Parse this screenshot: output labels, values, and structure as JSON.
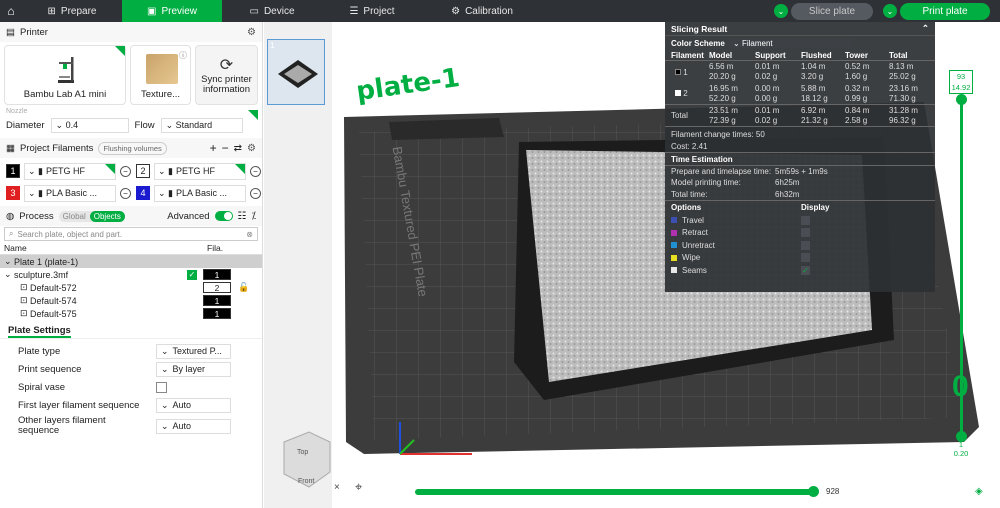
{
  "tabs": [
    {
      "label": "Prepare",
      "icon": "prepare-icon"
    },
    {
      "label": "Preview",
      "icon": "preview-icon"
    },
    {
      "label": "Device",
      "icon": "device-icon"
    },
    {
      "label": "Project",
      "icon": "project-icon"
    },
    {
      "label": "Calibration",
      "icon": "calibration-icon"
    }
  ],
  "actions": {
    "slice": "Slice plate",
    "print": "Print plate"
  },
  "printer": {
    "title": "Printer",
    "name": "Bambu Lab A1 mini",
    "plate": "Texture...",
    "sync": "Sync printer information",
    "nozzle": "Nozzle",
    "diameter_label": "Diameter",
    "diameter": "0.4",
    "flow_label": "Flow",
    "flow": "Standard"
  },
  "filaments": {
    "title": "Project Filaments",
    "flushing": "Flushing volumes",
    "items": [
      {
        "num": "1",
        "name": "PETG HF",
        "color": "#000000"
      },
      {
        "num": "2",
        "name": "PETG HF",
        "color": "#ffffff"
      },
      {
        "num": "3",
        "name": "PLA Basic ...",
        "color": "#e02020"
      },
      {
        "num": "4",
        "name": "PLA Basic ...",
        "color": "#1a1ad0"
      }
    ]
  },
  "process": {
    "title": "Process",
    "global": "Global",
    "objects": "Objects",
    "advanced": "Advanced",
    "search": "Search plate, object and part.",
    "col_name": "Name",
    "col_fila": "Fila.",
    "rows": [
      {
        "name": "Plate 1 (plate-1)"
      },
      {
        "name": "sculpture.3mf",
        "fila": "1"
      },
      {
        "name": "Default-572",
        "fila": "2"
      },
      {
        "name": "Default-574",
        "fila": "1"
      },
      {
        "name": "Default-575",
        "fila": "1"
      }
    ]
  },
  "plate_settings": {
    "title": "Plate Settings",
    "rows": [
      {
        "label": "Plate type",
        "value": "Textured P..."
      },
      {
        "label": "Print sequence",
        "value": "By layer"
      },
      {
        "label": "Spiral vase",
        "value": ""
      },
      {
        "label": "First layer filament sequence",
        "value": "Auto"
      },
      {
        "label": "Other layers filament sequence",
        "value": "Auto"
      }
    ]
  },
  "viewport": {
    "plate_label": "plate-1",
    "bed_text": "Bambu Textured PEI Plate",
    "cube_top": "Top",
    "cube_front": "Front",
    "layer_top": "93",
    "layer_top_h": "14.92",
    "layer_bot": "1",
    "layer_bot_h": "0.20",
    "move_value": "928"
  },
  "slicing": {
    "title": "Slicing Result",
    "scheme_label": "Color Scheme",
    "scheme": "Filament",
    "headers": [
      "Filament",
      "Model",
      "Support",
      "Flushed",
      "Tower",
      "Total"
    ],
    "rows": [
      {
        "f": "1",
        "c": "#000000",
        "model": [
          "6.56 m",
          "20.20 g"
        ],
        "support": [
          "0.01 m",
          "0.02 g"
        ],
        "flushed": [
          "1.04 m",
          "3.20 g"
        ],
        "tower": [
          "0.52 m",
          "1.60 g"
        ],
        "total": [
          "8.13 m",
          "25.02 g"
        ]
      },
      {
        "f": "2",
        "c": "#ffffff",
        "model": [
          "16.95 m",
          "52.20 g"
        ],
        "support": [
          "0.00 m",
          "0.00 g"
        ],
        "flushed": [
          "5.88 m",
          "18.12 g"
        ],
        "tower": [
          "0.32 m",
          "0.99 g"
        ],
        "total": [
          "23.16 m",
          "71.30 g"
        ]
      }
    ],
    "total": {
      "label": "Total",
      "model": [
        "23.51 m",
        "72.39 g"
      ],
      "support": [
        "0.01 m",
        "0.02 g"
      ],
      "flushed": [
        "6.92 m",
        "21.32 g"
      ],
      "tower": [
        "0.84 m",
        "2.58 g"
      ],
      "total": [
        "31.28 m",
        "96.32 g"
      ]
    },
    "change": "Filament change times:  50",
    "cost": "Cost:  2.41",
    "time_title": "Time Estimation",
    "times": [
      {
        "l": "Prepare and timelapse time:",
        "v": "5m59s + 1m9s"
      },
      {
        "l": "Model printing time:",
        "v": "6h25m"
      },
      {
        "l": "Total time:",
        "v": "6h32m"
      }
    ],
    "options_h": "Options",
    "display_h": "Display",
    "options": [
      {
        "n": "Travel",
        "c": "#3a4fb0"
      },
      {
        "n": "Retract",
        "c": "#b030b0"
      },
      {
        "n": "Unretract",
        "c": "#2090d0"
      },
      {
        "n": "Wipe",
        "c": "#e8e020"
      },
      {
        "n": "Seams",
        "c": "#e8e8e8"
      }
    ]
  }
}
